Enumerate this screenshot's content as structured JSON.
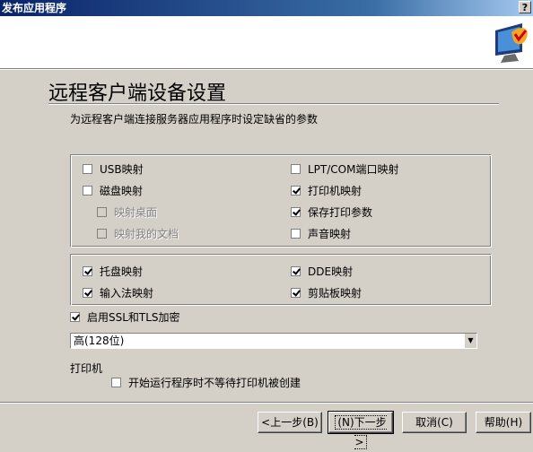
{
  "window": {
    "title": "发布应用程序",
    "help": "?"
  },
  "page": {
    "title": "远程客户端设备设置",
    "subtitle": "为远程客户端连接服务器应用程序时设定缺省的参数"
  },
  "group1": [
    {
      "label": "USB映射",
      "checked": false,
      "disabled": false
    },
    {
      "label": "磁盘映射",
      "checked": false,
      "disabled": false
    },
    {
      "label": "映射桌面",
      "checked": false,
      "disabled": true
    },
    {
      "label": "映射我的文档",
      "checked": false,
      "disabled": true
    },
    {
      "label": "LPT/COM端口映射",
      "checked": false,
      "disabled": false
    },
    {
      "label": "打印机映射",
      "checked": true,
      "disabled": false
    },
    {
      "label": "保存打印参数",
      "checked": true,
      "disabled": false
    },
    {
      "label": "声音映射",
      "checked": false,
      "disabled": false
    }
  ],
  "group2": [
    {
      "label": "托盘映射",
      "checked": true
    },
    {
      "label": "输入法映射",
      "checked": true
    },
    {
      "label": "DDE映射",
      "checked": true
    },
    {
      "label": "剪贴板映射",
      "checked": true
    }
  ],
  "ssl": {
    "label": "启用SSL和TLS加密",
    "checked": true
  },
  "encryption": {
    "value": "高(128位)"
  },
  "printer": {
    "section_label": "打印机",
    "option_label": "开始运行程序时不等待打印机被创建",
    "option_checked": false
  },
  "buttons": {
    "back": "<上一步(B)",
    "next": "(N)下一步>",
    "cancel": "取消(C)",
    "help": "帮助(H)"
  }
}
